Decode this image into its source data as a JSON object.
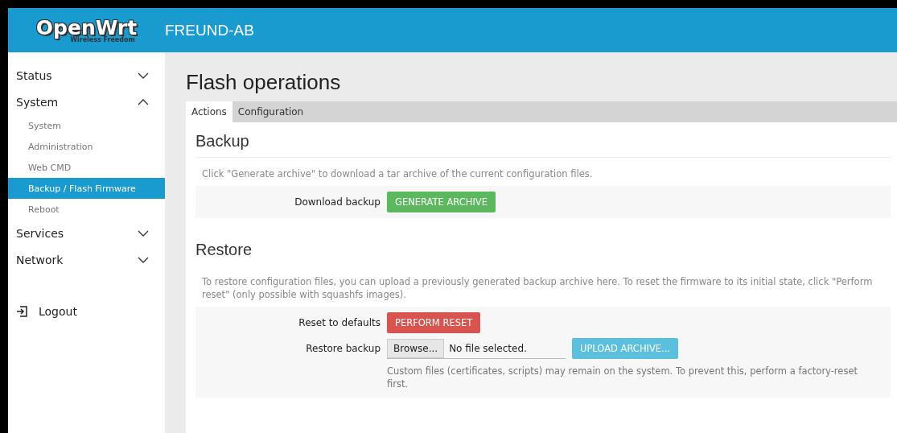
{
  "header": {
    "logo": "OpenWrt",
    "logo_tagline": "Wireless Freedom",
    "hostname": "FREUND-AB"
  },
  "sidebar": {
    "items": [
      {
        "label": "Status",
        "expanded": false
      },
      {
        "label": "System",
        "expanded": true,
        "children": [
          {
            "label": "System",
            "selected": false
          },
          {
            "label": "Administration",
            "selected": false
          },
          {
            "label": "Web CMD",
            "selected": false
          },
          {
            "label": "Backup / Flash Firmware",
            "selected": true
          },
          {
            "label": "Reboot",
            "selected": false
          }
        ]
      },
      {
        "label": "Services",
        "expanded": false
      },
      {
        "label": "Network",
        "expanded": false
      }
    ],
    "logout": "Logout"
  },
  "page": {
    "title": "Flash operations",
    "tabs": [
      {
        "label": "Actions",
        "selected": true
      },
      {
        "label": "Configuration",
        "selected": false
      }
    ],
    "sections": [
      {
        "title": "Backup",
        "description": "Click \"Generate archive\" to download a tar archive of the current configuration files.",
        "rows": [
          {
            "label": "Download backup",
            "kind": "button",
            "button": {
              "label": "GENERATE ARCHIVE",
              "color": "#5cb85c"
            }
          }
        ]
      },
      {
        "title": "Restore",
        "description": "To restore configuration files, you can upload a previously generated backup archive here. To reset the firmware to its initial state, click \"Perform reset\" (only possible with squashfs images).",
        "rows": [
          {
            "label": "Reset to defaults",
            "kind": "button",
            "button": {
              "label": "PERFORM RESET",
              "color": "#d9534f"
            }
          },
          {
            "label": "Restore backup",
            "kind": "file",
            "browse": "Browse...",
            "file_status": "No file selected.",
            "button": {
              "label": "UPLOAD ARCHIVE...",
              "color": "#5bc0de"
            },
            "help": "Custom files (certificates, scripts) may remain on the system. To prevent this, perform a factory-reset first."
          }
        ]
      }
    ]
  }
}
